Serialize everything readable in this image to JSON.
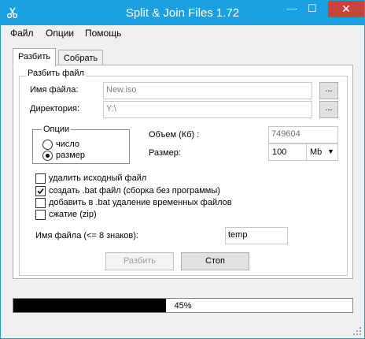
{
  "window": {
    "title": "Split & Join Files 1.72",
    "minimize_glyph": "—",
    "maximize_glyph": "☐",
    "close_glyph": "✕"
  },
  "menu": {
    "items": [
      "Файл",
      "Опции",
      "Помощь"
    ]
  },
  "tabs": [
    {
      "label": "Разбить",
      "active": true
    },
    {
      "label": "Собрать",
      "active": false
    }
  ],
  "split_group": {
    "title": "Разбить файл",
    "filename_label": "Имя файла:",
    "filename_value": "New.iso",
    "directory_label": "Директория:",
    "directory_value": "Y:\\",
    "browse_label": "...",
    "options_title": "Опции",
    "radio_number_label": "число",
    "radio_size_label": "размер",
    "radio_selected": "размер",
    "volume_label": "Объем (Кб) :",
    "volume_value": "749604",
    "size_label": "Размер:",
    "size_value": "100",
    "size_unit": "Mb",
    "checkboxes": [
      {
        "label": "удалить исходный файл",
        "checked": false
      },
      {
        "label": "создать .bat файл (сборка без программы)",
        "checked": true
      },
      {
        "label": "добавить в .bat удаление временных файлов",
        "checked": false
      },
      {
        "label": "сжатие (zip)",
        "checked": false
      }
    ],
    "namelen_label": "Имя файла (<= 8 знаков):",
    "namelen_value": "temp",
    "split_button": "Разбить",
    "stop_button": "Стоп"
  },
  "progress": {
    "value": 0.45,
    "text": "45%"
  },
  "colors": {
    "titlebar": "#1ba1e2",
    "close": "#c7443c",
    "progress_fill": "#000000"
  }
}
